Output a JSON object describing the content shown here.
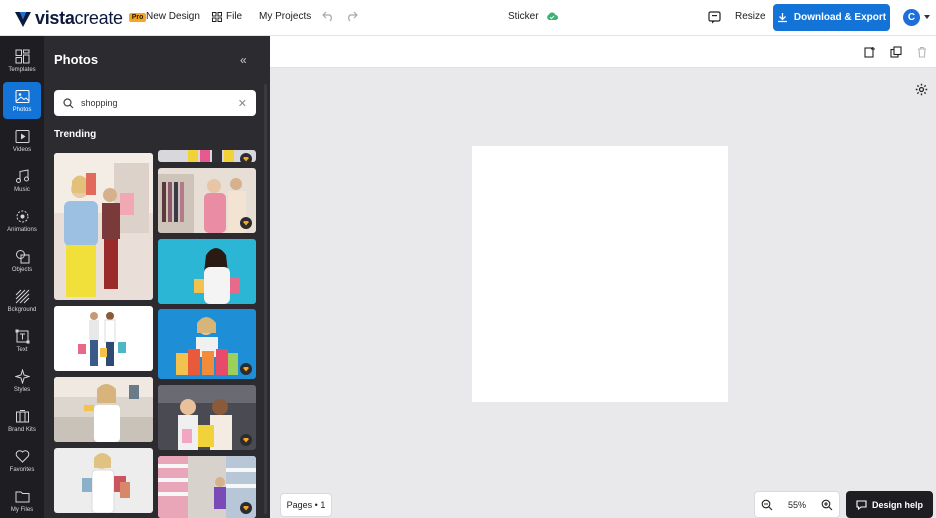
{
  "brand": {
    "name_bold": "vista",
    "name_light": "create",
    "badge": "Pro"
  },
  "topbar": {
    "new_design": "New Design",
    "file": "File",
    "my_projects": "My Projects",
    "document_title": "Sticker",
    "resize": "Resize",
    "download": "Download & Export",
    "avatar_initial": "C"
  },
  "colors": {
    "accent": "#1473d6",
    "rail_bg": "#1e1e22",
    "panel_bg": "#2b2b30",
    "premium": "#f6a623"
  },
  "rail": {
    "items": [
      {
        "label": "Templates",
        "icon": "templates-icon"
      },
      {
        "label": "Photos",
        "icon": "photos-icon",
        "active": true
      },
      {
        "label": "Videos",
        "icon": "videos-icon"
      },
      {
        "label": "Music",
        "icon": "music-icon"
      },
      {
        "label": "Animations",
        "icon": "animations-icon"
      },
      {
        "label": "Objects",
        "icon": "objects-icon"
      },
      {
        "label": "Bckground",
        "icon": "background-icon"
      },
      {
        "label": "Text",
        "icon": "text-icon"
      },
      {
        "label": "Styles",
        "icon": "styles-icon"
      },
      {
        "label": "Brand Kits",
        "icon": "brand-kits-icon"
      },
      {
        "label": "Favorites",
        "icon": "favorites-icon"
      },
      {
        "label": "My Files",
        "icon": "my-files-icon"
      }
    ]
  },
  "panel": {
    "title": "Photos",
    "search": {
      "value": "shopping"
    },
    "section": "Trending"
  },
  "canvas": {
    "pages_label": "Pages • 1",
    "zoom": "55%",
    "design_help": "Design help"
  }
}
